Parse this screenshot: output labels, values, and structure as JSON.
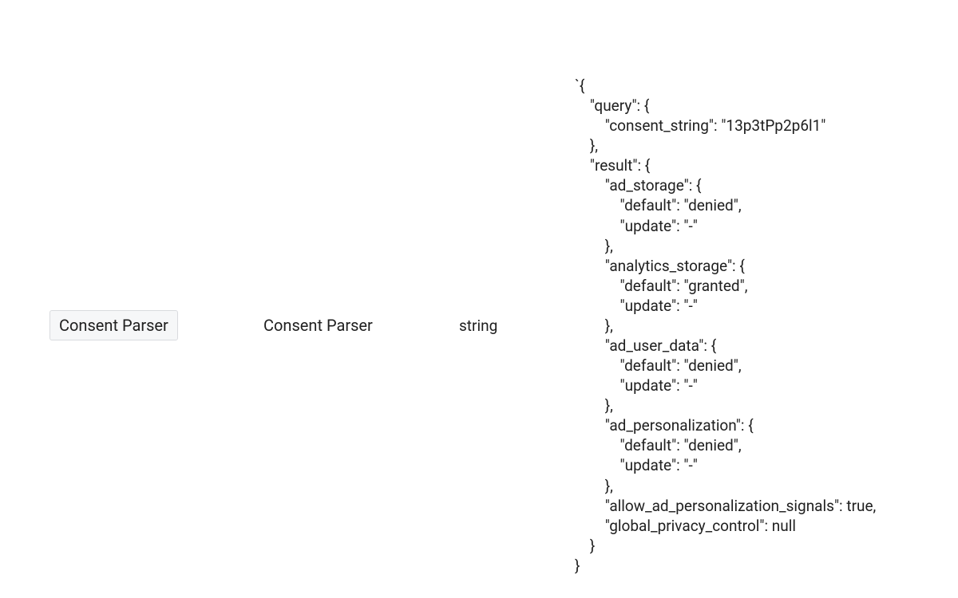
{
  "row": {
    "chip_label": "Consent Parser",
    "name_label": "Consent Parser",
    "type_label": "string",
    "value_text": "`{\n    \"query\": {\n        \"consent_string\": \"13p3tPp2p6l1\"\n    },\n    \"result\": {\n        \"ad_storage\": {\n            \"default\": \"denied\",\n            \"update\": \"-\"\n        },\n        \"analytics_storage\": {\n            \"default\": \"granted\",\n            \"update\": \"-\"\n        },\n        \"ad_user_data\": {\n            \"default\": \"denied\",\n            \"update\": \"-\"\n        },\n        \"ad_personalization\": {\n            \"default\": \"denied\",\n            \"update\": \"-\"\n        },\n        \"allow_ad_personalization_signals\": true,\n        \"global_privacy_control\": null\n    }\n}"
  }
}
